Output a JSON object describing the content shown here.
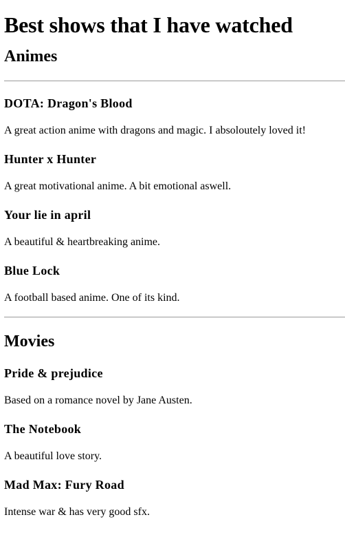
{
  "title": "Best shows that I have watched",
  "sections": [
    {
      "heading": "Animes",
      "items": [
        {
          "name": "DOTA: Dragon's Blood",
          "description": "A great action anime with dragons and magic. I absoloutely loved it!"
        },
        {
          "name": "Hunter x Hunter",
          "description": "A great motivational anime. A bit emotional aswell."
        },
        {
          "name": "Your lie in april",
          "description": "A beautiful & heartbreaking anime."
        },
        {
          "name": "Blue Lock",
          "description": "A football based anime. One of its kind."
        }
      ]
    },
    {
      "heading": "Movies",
      "items": [
        {
          "name": "Pride & prejudice",
          "description": "Based on a romance novel by Jane Austen."
        },
        {
          "name": "The Notebook",
          "description": "A beautiful love story."
        },
        {
          "name": "Mad Max: Fury Road",
          "description": "Intense war & has very good sfx."
        }
      ]
    }
  ],
  "colors": {
    "text": "#000000",
    "background": "#ffffff",
    "divider": "#9a9a9a"
  }
}
